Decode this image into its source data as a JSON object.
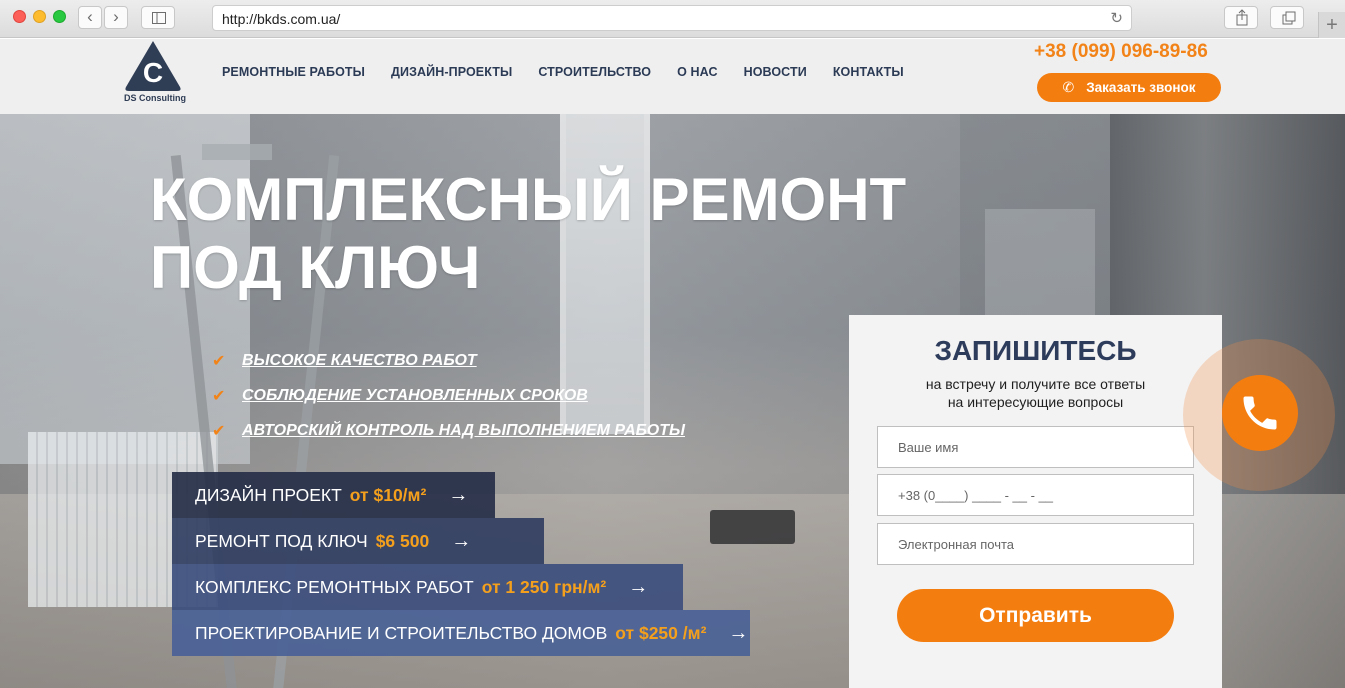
{
  "browser": {
    "url": "http://bkds.com.ua/"
  },
  "header": {
    "logo_caption": "DS Consulting",
    "logo_letter": "C",
    "menu": [
      "РЕМОНТНЫЕ РАБОТЫ",
      "ДИЗАЙН-ПРОЕКТЫ",
      "СТРОИТЕЛЬСТВО",
      "О НАС",
      "НОВОСТИ",
      "КОНТАКТЫ"
    ],
    "phone": "+38 (099) 096-89-86",
    "call_button": "Заказать звонок"
  },
  "hero": {
    "title_line1": "КОМПЛЕКСНЫЙ РЕМОНТ",
    "title_line2": "ПОД КЛЮЧ",
    "features": [
      "ВЫСОКОЕ КАЧЕСТВО РАБОТ",
      "СОБЛЮДЕНИЕ УСТАНОВЛЕННЫХ СРОКОВ",
      "АВТОРСКИЙ КОНТРОЛЬ НАД ВЫПОЛНЕНИЕМ РАБОТЫ"
    ],
    "services": [
      {
        "label": "ДИЗАЙН ПРОЕКТ",
        "price": "от $10/м²"
      },
      {
        "label": "РЕМОНТ ПОД КЛЮЧ",
        "price": "$6 500"
      },
      {
        "label": "КОМПЛЕКС РЕМОНТНЫХ РАБОТ",
        "price": "от 1 250 грн/м²"
      },
      {
        "label": "ПРОЕКТИРОВАНИЕ И СТРОИТЕЛЬСТВО ДОМОВ",
        "price": "от $250 /м²"
      }
    ]
  },
  "form": {
    "title": "ЗАПИШИТЕСЬ",
    "subtitle_line1": "на встречу и получите все ответы",
    "subtitle_line2": "на интересующие вопросы",
    "name_placeholder": "Ваше имя",
    "phone_placeholder": "+38 (0____) ____ - __ - __",
    "email_placeholder": "Электронная почта",
    "submit": "Отправить"
  },
  "colors": {
    "accent": "#f47d10",
    "navy": "#2e3c5c"
  }
}
